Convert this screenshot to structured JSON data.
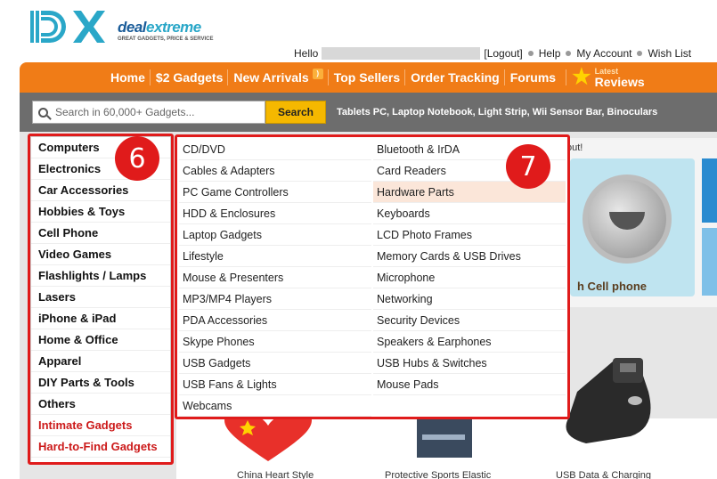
{
  "brand": {
    "logo_mark": "DX",
    "name_part1": "deal",
    "name_part2": "extreme",
    "tagline": "GREAT GADGETS, PRICE & SERVICE"
  },
  "userbar": {
    "hello": "Hello",
    "logout": "[Logout]",
    "help": "Help",
    "my_account": "My Account",
    "wish_list": "Wish List"
  },
  "nav": {
    "items": [
      "Home",
      "$2 Gadgets",
      "New Arrivals",
      "Top Sellers",
      "Order Tracking",
      "Forums"
    ],
    "reviews_small": "Latest",
    "reviews_big": "Reviews"
  },
  "search": {
    "placeholder": "Search in 60,000+ Gadgets...",
    "button": "Search",
    "tags": "Tablets PC, Laptop Notebook, Light Strip, Wii Sensor Bar, Binoculars"
  },
  "sidebar": {
    "items": [
      "Computers",
      "Electronics",
      "Car Accessories",
      "Hobbies & Toys",
      "Cell Phone",
      "Video Games",
      "Flashlights / Lamps",
      "Lasers",
      "iPhone & iPad",
      "Home & Office",
      "Apparel",
      "DIY Parts & Tools",
      "Others",
      "Intimate Gadgets",
      "Hard-to-Find Gadgets"
    ]
  },
  "flyout": {
    "col1": [
      "CD/DVD",
      "Cables & Adapters",
      "PC Game Controllers",
      "HDD & Enclosures",
      "Laptop Gadgets",
      "Lifestyle",
      "Mouse & Presenters",
      "MP3/MP4 Players",
      "PDA Accessories",
      "Skype Phones",
      "USB Gadgets",
      "USB Fans & Lights",
      "Webcams"
    ],
    "col2": [
      "Bluetooth & IrDA",
      "Card Readers",
      "Hardware Parts",
      "Keyboards",
      "LCD Photo Frames",
      "Memory Cards & USB Drives",
      "Microphone",
      "Networking",
      "Security Devices",
      "Speakers & Earphones",
      "USB Hubs & Switches",
      "Mouse Pads"
    ]
  },
  "annotations": {
    "sidebar_number": "6",
    "flyout_number": "7"
  },
  "promo": {
    "top_text": "out!",
    "caption": "h Cell phone"
  },
  "products": {
    "cap1": "China Heart Style",
    "cap2": "Protective Sports Elastic",
    "cap3": "USB Data & Charging"
  },
  "colors": {
    "nav_orange": "#f07c17",
    "annotation_red": "#e01b1b",
    "search_yellow": "#f5b800",
    "highlight": "#fbe6d9"
  }
}
